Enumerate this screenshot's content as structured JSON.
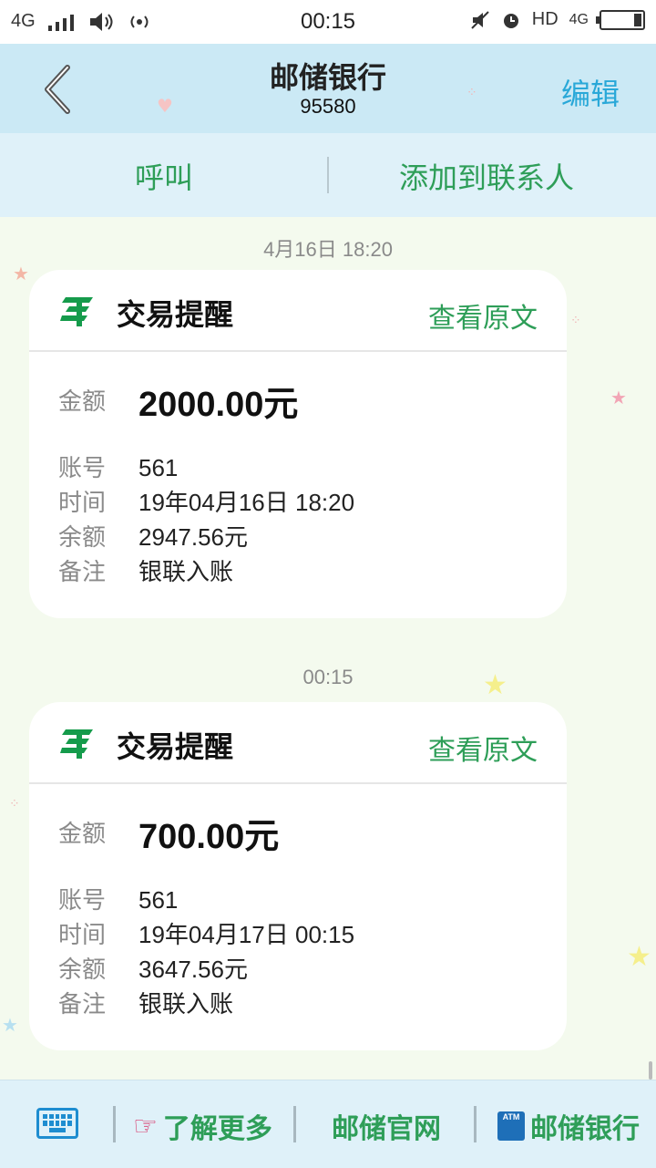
{
  "status_bar": {
    "network": "4G",
    "time": "00:15",
    "hd": "HD",
    "network_right": "4G"
  },
  "header": {
    "title": "邮储银行",
    "number": "95580",
    "edit_label": "编辑"
  },
  "actions": {
    "call_label": "呼叫",
    "add_contact_label": "添加到联系人"
  },
  "messages": [
    {
      "timestamp": "4月16日 18:20",
      "card_title": "交易提醒",
      "view_original": "查看原文",
      "amount_label": "金额",
      "amount": "2000.00元",
      "fields": [
        {
          "key": "账号",
          "value": "561"
        },
        {
          "key": "时间",
          "value": "19年04月16日 18:20"
        },
        {
          "key": "余额",
          "value": "2947.56元"
        },
        {
          "key": "备注",
          "value": "银联入账"
        }
      ]
    },
    {
      "timestamp": "00:15",
      "card_title": "交易提醒",
      "view_original": "查看原文",
      "amount_label": "金额",
      "amount": "700.00元",
      "fields": [
        {
          "key": "账号",
          "value": "561"
        },
        {
          "key": "时间",
          "value": "19年04月17日 00:15"
        },
        {
          "key": "余额",
          "value": "3647.56元"
        },
        {
          "key": "备注",
          "value": "银联入账"
        }
      ]
    }
  ],
  "bottom_bar": {
    "learn_more": "了解更多",
    "official_site": "邮储官网",
    "bank": "邮储银行",
    "atm_badge": "ATM"
  },
  "colors": {
    "accent_green": "#2e9e58",
    "header_bg": "#cbe9f5",
    "edit_blue": "#29a8d8"
  }
}
